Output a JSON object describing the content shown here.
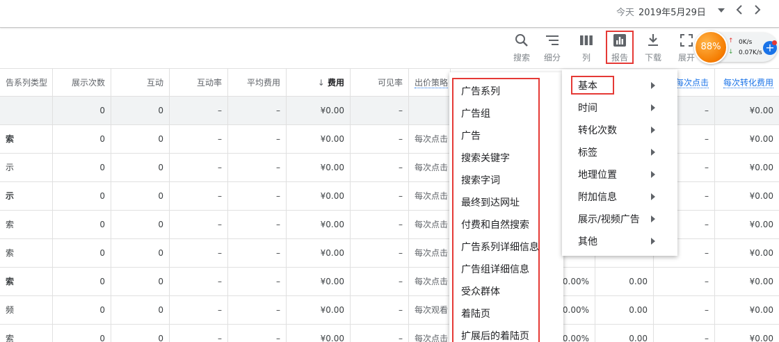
{
  "date_bar": {
    "label": "今天",
    "value": "2019年5月29日"
  },
  "toolbar": [
    {
      "key": "search",
      "label": "搜索",
      "icon": "search-icon"
    },
    {
      "key": "segment",
      "label": "细分",
      "icon": "segment-icon"
    },
    {
      "key": "columns",
      "label": "列",
      "icon": "columns-icon"
    },
    {
      "key": "report",
      "label": "报告",
      "icon": "report-icon"
    },
    {
      "key": "download",
      "label": "下载",
      "icon": "download-icon"
    },
    {
      "key": "expand",
      "label": "展开",
      "icon": "expand-icon"
    }
  ],
  "network": {
    "percent": "88%",
    "up": "0K/s",
    "down": "0.07K/s"
  },
  "table": {
    "headers": {
      "type": "告系列类型",
      "impressions": "展示次数",
      "interactions": "互动",
      "interaction_rate": "互动率",
      "avg_cost": "平均费用",
      "cost": "费用",
      "cost_arrow": "↓",
      "viewability": "可见率",
      "bid_strategy": "出价策略",
      "per_conv_c": "每次点击",
      "per_conv_cost": "每次转化费用"
    },
    "total_row": {
      "impressions": "0",
      "interactions": "0",
      "interaction_rate": "–",
      "avg_cost": "–",
      "cost": "¥0.00",
      "viewability": "–",
      "per_conv_c": "–",
      "per_conv_cost": "¥0.00"
    },
    "rows": [
      {
        "type": "索",
        "bold": true,
        "impressions": "0",
        "interactions": "0",
        "interaction_rate": "–",
        "avg_cost": "–",
        "cost": "¥0.00",
        "viewability": "–",
        "bid_strategy": "每次点击",
        "conv_rate": "",
        "conv": "",
        "per_conv_c": "–",
        "per_conv_cost": "¥0.00"
      },
      {
        "type": "示",
        "bold": false,
        "impressions": "0",
        "interactions": "0",
        "interaction_rate": "–",
        "avg_cost": "–",
        "cost": "¥0.00",
        "viewability": "–",
        "bid_strategy": "每次点击",
        "conv_rate": "",
        "conv": "",
        "per_conv_c": "–",
        "per_conv_cost": "¥0.00"
      },
      {
        "type": "示",
        "bold": true,
        "impressions": "0",
        "interactions": "0",
        "interaction_rate": "–",
        "avg_cost": "–",
        "cost": "¥0.00",
        "viewability": "–",
        "bid_strategy": "每次点击",
        "conv_rate": "",
        "conv": "",
        "per_conv_c": "–",
        "per_conv_cost": "¥0.00"
      },
      {
        "type": "索",
        "bold": false,
        "impressions": "0",
        "interactions": "0",
        "interaction_rate": "–",
        "avg_cost": "–",
        "cost": "¥0.00",
        "viewability": "–",
        "bid_strategy": "每次点击",
        "conv_rate": "",
        "conv": "",
        "per_conv_c": "–",
        "per_conv_cost": "¥0.00"
      },
      {
        "type": "索",
        "bold": false,
        "impressions": "0",
        "interactions": "0",
        "interaction_rate": "–",
        "avg_cost": "–",
        "cost": "¥0.00",
        "viewability": "–",
        "bid_strategy": "每次点击",
        "conv_rate": "",
        "conv": "",
        "per_conv_c": "–",
        "per_conv_cost": "¥0.00"
      },
      {
        "type": "索",
        "bold": true,
        "impressions": "0",
        "interactions": "0",
        "interaction_rate": "–",
        "avg_cost": "–",
        "cost": "¥0.00",
        "viewability": "–",
        "bid_strategy": "每次点击",
        "conv_rate": "0.00%",
        "conv": "0.00",
        "per_conv_c": "–",
        "per_conv_cost": "¥0.00"
      },
      {
        "type": "频",
        "bold": false,
        "impressions": "0",
        "interactions": "0",
        "interaction_rate": "–",
        "avg_cost": "–",
        "cost": "¥0.00",
        "viewability": "–",
        "bid_strategy": "每次观看",
        "conv_rate": "0.00%",
        "conv": "0.00",
        "per_conv_c": "–",
        "per_conv_cost": "¥0.00"
      },
      {
        "type": "索",
        "bold": false,
        "impressions": "0",
        "interactions": "0",
        "interaction_rate": "–",
        "avg_cost": "–",
        "cost": "¥0.00",
        "viewability": "–",
        "bid_strategy": "每次点击",
        "conv_rate": "0.00%",
        "conv": "0.00",
        "per_conv_c": "–",
        "per_conv_cost": "¥0.00"
      }
    ]
  },
  "report_menu_categories": [
    "基本",
    "时间",
    "转化次数",
    "标签",
    "地理位置",
    "附加信息",
    "展示/视频广告",
    "其他"
  ],
  "report_menu_basic_items": [
    "广告系列",
    "广告组",
    "广告",
    "搜索关键字",
    "搜索字词",
    "最终到达网址",
    "付费和自然搜索",
    "广告系列详细信息",
    "广告组详细信息",
    "受众群体",
    "着陆页",
    "扩展后的着陆页"
  ],
  "colors": {
    "highlight_box": "#e53935",
    "link": "#1a73e8",
    "net_ball": "#f57c00"
  }
}
